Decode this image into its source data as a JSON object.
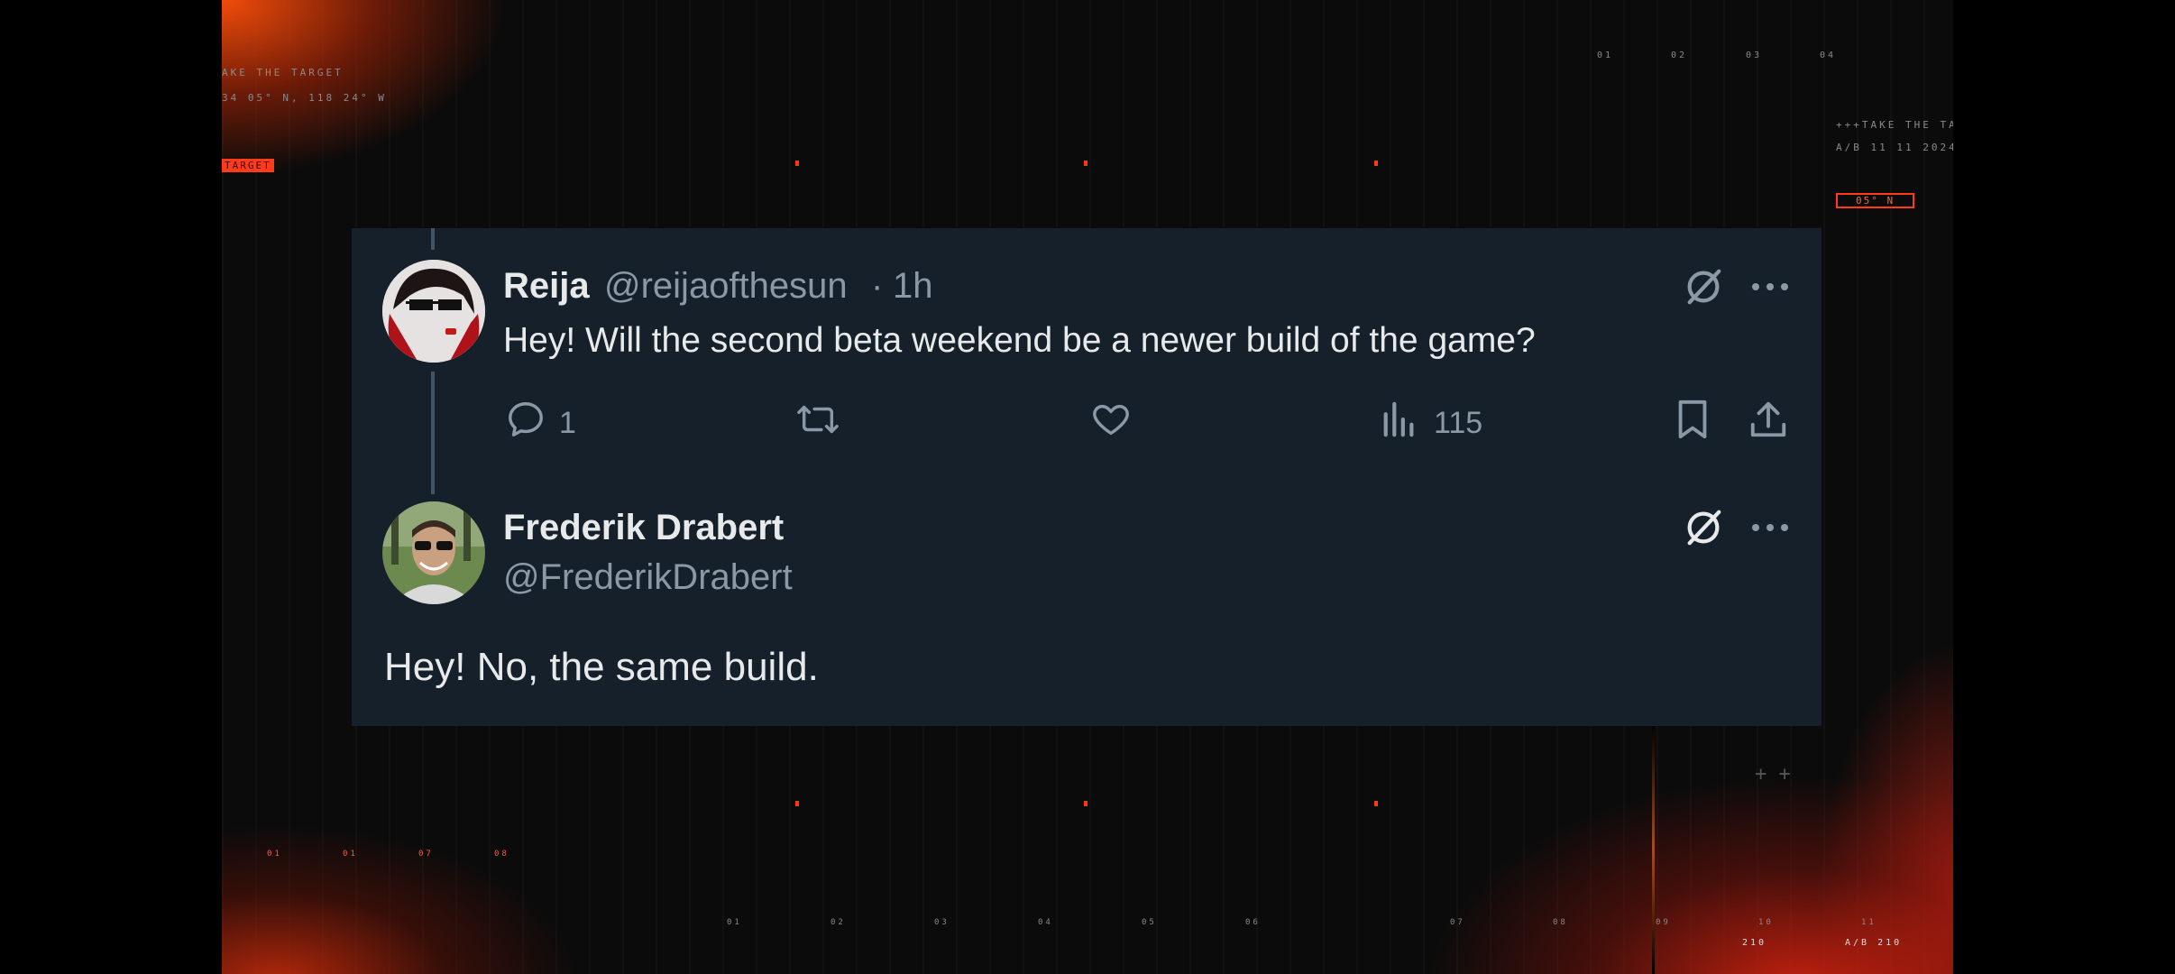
{
  "background": {
    "hud_texts": [
      "AKE THE TARGET",
      "34 05° N, 118 24° W",
      "TARGET",
      "01",
      "02",
      "03",
      "04",
      "+++TAKE THE TA",
      "A/B 11 11 2024",
      "05° N",
      "01",
      "01",
      "07",
      "08",
      "01",
      "02",
      "03",
      "04",
      "05",
      "06",
      "07",
      "08",
      "09",
      "10",
      "11",
      "210",
      "A/B 210"
    ],
    "accent_color": "#ff3b1a"
  },
  "tweet": {
    "display_name": "Reija",
    "handle": "@reijaofthesun",
    "separator": "·",
    "time": "1h",
    "text": "Hey! Will the second beta weekend be a newer build of the game?",
    "reply_count": "1",
    "view_count": "115"
  },
  "reply": {
    "display_name": "Frederik Drabert",
    "handle": "@FrederikDrabert",
    "text": "Hey! No, the same build."
  },
  "colors": {
    "card_bg": "#15202b",
    "text": "#e7e9ea",
    "muted": "#8b98a5",
    "thread_line": "#425364"
  },
  "icons": [
    "reply-icon",
    "retweet-icon",
    "like-icon",
    "views-icon",
    "bookmark-icon",
    "share-icon",
    "grok-icon",
    "more-icon"
  ]
}
